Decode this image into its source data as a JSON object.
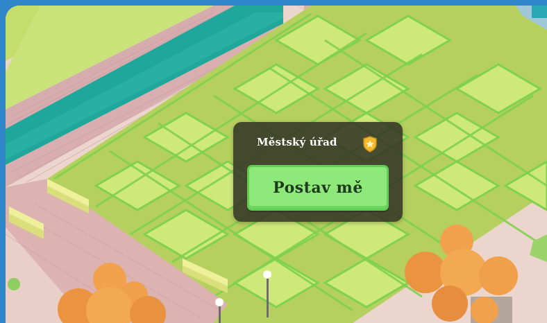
{
  "building_popup": {
    "title": "Městský úřad",
    "badge_icon": "shield-star-icon",
    "build_button_label": "Postav mě"
  },
  "colors": {
    "frame": "#2f86c9",
    "lawn_light": "#c8e36c",
    "lawn_dark": "#b7d25f",
    "lawn_lines": "#7fd14f",
    "water": "#1fa79b",
    "pavement": "#e6c9c3",
    "cobble": "#d8aeb0",
    "tree_foliage": "#f0a04a",
    "popup_bg": "#343426",
    "button_green": "#8ee87a",
    "badge_gold": "#f1b92d"
  }
}
